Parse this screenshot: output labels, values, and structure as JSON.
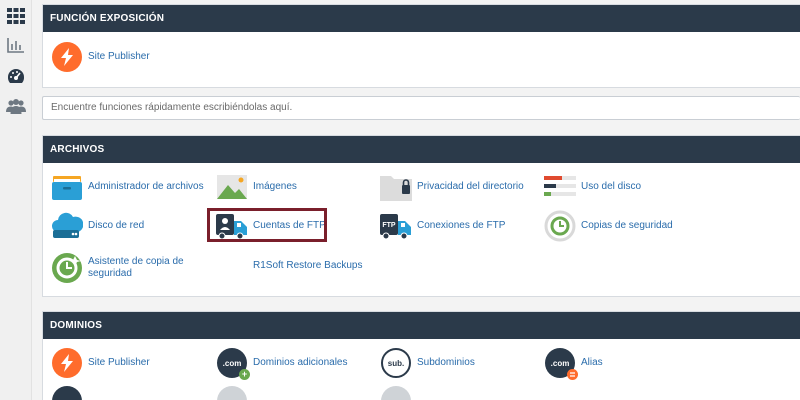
{
  "sidebar": {
    "icons": [
      "apps-grid-icon",
      "stats-chart-icon",
      "dashboard-gauge-icon",
      "users-icon"
    ]
  },
  "exposure": {
    "title": "FUNCIÓN EXPOSICIÓN",
    "items": [
      {
        "label": "Site Publisher",
        "icon": "site-publisher-icon"
      }
    ]
  },
  "search": {
    "placeholder": "Encuentre funciones rápidamente escribiéndolas aquí."
  },
  "files": {
    "title": "ARCHIVOS",
    "items": [
      {
        "label": "Administrador de archivos",
        "icon": "file-manager-icon"
      },
      {
        "label": "Imágenes",
        "icon": "images-icon"
      },
      {
        "label": "Privacidad del directorio",
        "icon": "directory-privacy-icon"
      },
      {
        "label": "Uso del disco",
        "icon": "disk-usage-icon"
      },
      {
        "label": "Disco de red",
        "icon": "web-disk-icon"
      },
      {
        "label": "Cuentas de FTP",
        "icon": "ftp-accounts-icon"
      },
      {
        "label": "Conexiones de FTP",
        "icon": "ftp-connections-icon"
      },
      {
        "label": "Copias de seguridad",
        "icon": "backup-icon"
      },
      {
        "label": "Asistente de copia de seguridad",
        "icon": "backup-wizard-icon"
      },
      {
        "label": "R1Soft Restore Backups",
        "icon": ""
      }
    ]
  },
  "domains": {
    "title": "DOMINIOS",
    "items": [
      {
        "label": "Site Publisher",
        "icon": "site-publisher-icon"
      },
      {
        "label": "Dominios adicionales",
        "icon": "addon-domains-icon",
        "badge": ".com"
      },
      {
        "label": "Subdominios",
        "icon": "subdomains-icon",
        "badge": "sub."
      },
      {
        "label": "Alias",
        "icon": "aliases-icon",
        "badge": ".com"
      }
    ]
  },
  "colors": {
    "header": "#2b3a4a",
    "link": "#2a6cab",
    "accent": "#ff6c2c",
    "highlight": "#7a1f2b"
  }
}
